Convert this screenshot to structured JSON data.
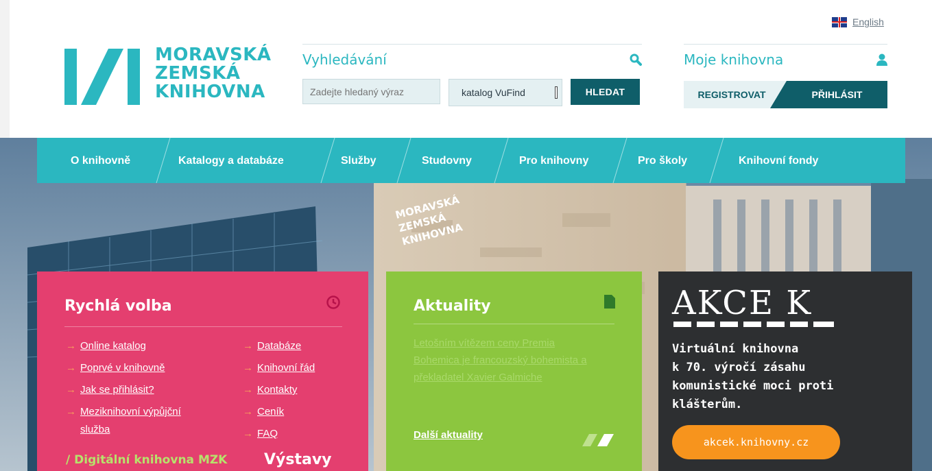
{
  "header": {
    "language_label": "English",
    "logo_lines": [
      "MORAVSKÁ",
      "ZEMSKÁ",
      "KNIHOVNA"
    ],
    "search": {
      "title": "Vyhledávání",
      "placeholder": "Zadejte hledaný výraz",
      "select_value": "katalog VuFind",
      "button_label": "HLEDAT"
    },
    "account": {
      "title": "Moje knihovna",
      "register_label": "REGISTROVAT",
      "login_label": "PŘIHLÁSIT"
    }
  },
  "nav": {
    "items": [
      "O knihovně",
      "Katalogy a databáze",
      "Služby",
      "Studovny",
      "Pro knihovny",
      "Pro školy",
      "Knihovní fondy"
    ]
  },
  "hero": {
    "building_sign": [
      "MORAVSKÁ",
      "ZEMSKÁ",
      "KNIHOVNA"
    ]
  },
  "quick": {
    "title": "Rychlá volba",
    "col1": [
      "Online katalog",
      "Poprvé v knihovně",
      "Jak se přihlásit?",
      "Meziknihovní výpůjční"
    ],
    "col1_wrap": "služba",
    "col2": [
      "Databáze",
      "Knihovní řád",
      "Kontakty",
      "Ceník",
      "FAQ"
    ],
    "digital_link": "Digitální knihovna MZK",
    "exhibitions": "Výstavy"
  },
  "news": {
    "title": "Aktuality",
    "headline": "Letošním vítězem ceny Premia Bohemica je francouzský bohemista a překladatel Xavier Galmiche",
    "more_label": "Další aktuality"
  },
  "promo": {
    "title": "AKCE K",
    "lines": [
      "Virtuální knihovna",
      "k 70. výročí zásahu",
      "komunistické moci proti",
      "klášterům."
    ],
    "button_label": "akcek.knihovny.cz"
  },
  "colors": {
    "teal": "#2bb7c0",
    "dark_teal": "#0f5e69",
    "pink": "#e43f6f",
    "green": "#8cc63f",
    "dark": "#2d2f31",
    "orange": "#f7941d"
  }
}
